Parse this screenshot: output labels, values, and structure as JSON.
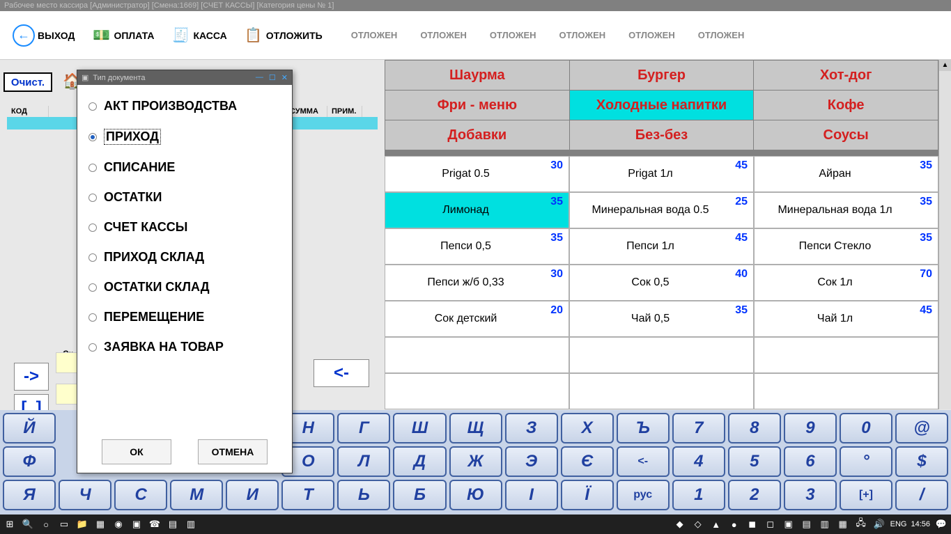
{
  "titlebar": "Рабочее место кассира  [Администратор] [Смена:1669] [СЧЕТ КАССЫ] [Категория цены № 1]",
  "toolbar": {
    "exit": "ВЫХОД",
    "pay": "ОПЛАТА",
    "cash": "КАССА",
    "defer": "ОТЛОЖИТЬ",
    "delayed": "ОТЛОЖЕН"
  },
  "left": {
    "clear": "Очист.",
    "cols": {
      "code": "КОД",
      "sum": "СУММА",
      "note": "ПРИМ."
    },
    "skidka": "Ск",
    "arrow_r": "->",
    "arrow_l": "<-",
    "brackets": "[..]"
  },
  "categories": [
    {
      "label": "Шаурма",
      "active": false
    },
    {
      "label": "Бургер",
      "active": false
    },
    {
      "label": "Хот-дог",
      "active": false
    },
    {
      "label": "Фри - меню",
      "active": false
    },
    {
      "label": "Холодные напитки",
      "active": true
    },
    {
      "label": "Кофе",
      "active": false
    },
    {
      "label": "Добавки",
      "active": false
    },
    {
      "label": "Без-без",
      "active": false
    },
    {
      "label": "Соусы",
      "active": false
    }
  ],
  "products": [
    {
      "name": "Prigat 0.5",
      "price": "30"
    },
    {
      "name": "Prigat 1л",
      "price": "45"
    },
    {
      "name": "Айран",
      "price": "35"
    },
    {
      "name": "Лимонад",
      "price": "35",
      "highlight": true
    },
    {
      "name": "Минеральная вода 0.5",
      "price": "25"
    },
    {
      "name": "Минеральная вода 1л",
      "price": "35"
    },
    {
      "name": "Пепси 0,5",
      "price": "35"
    },
    {
      "name": "Пепси 1л",
      "price": "45"
    },
    {
      "name": "Пепси Стекло",
      "price": "35"
    },
    {
      "name": "Пепси ж/б 0,33",
      "price": "30"
    },
    {
      "name": "Сок 0,5",
      "price": "40"
    },
    {
      "name": "Сок 1л",
      "price": "70"
    },
    {
      "name": "Сок детский",
      "price": "20"
    },
    {
      "name": "Чай 0,5",
      "price": "35"
    },
    {
      "name": "Чай 1л",
      "price": "45"
    }
  ],
  "keyboard": {
    "row1": [
      "Й",
      "",
      "",
      "",
      "",
      "Н",
      "Г",
      "Ш",
      "Щ",
      "З",
      "Х",
      "Ъ",
      "7",
      "8",
      "9",
      "0",
      "@"
    ],
    "row2": [
      "Ф",
      "",
      "",
      "",
      "",
      "О",
      "Л",
      "Д",
      "Ж",
      "Э",
      "Є",
      "<-",
      "4",
      "5",
      "6",
      "°",
      "$"
    ],
    "row3": [
      "Я",
      "Ч",
      "С",
      "М",
      "И",
      "Т",
      "Ь",
      "Б",
      "Ю",
      "І",
      "Ї",
      "рус",
      "1",
      "2",
      "3",
      "[+]",
      "/"
    ]
  },
  "dialog": {
    "title": "Тип документа",
    "items": [
      {
        "label": "АКТ ПРОИЗВОДСТВА",
        "selected": false
      },
      {
        "label": "ПРИХОД",
        "selected": true
      },
      {
        "label": "СПИСАНИЕ",
        "selected": false
      },
      {
        "label": "ОСТАТКИ",
        "selected": false
      },
      {
        "label": "СЧЕТ КАССЫ",
        "selected": false
      },
      {
        "label": "ПРИХОД СКЛАД",
        "selected": false
      },
      {
        "label": "ОСТАТКИ СКЛАД",
        "selected": false
      },
      {
        "label": "ПЕРЕМЕЩЕНИЕ",
        "selected": false
      },
      {
        "label": "ЗАЯВКА НА ТОВАР",
        "selected": false
      }
    ],
    "ok": "ОК",
    "cancel": "ОТМЕНА"
  },
  "taskbar": {
    "lang": "ENG",
    "time": "14:56"
  }
}
